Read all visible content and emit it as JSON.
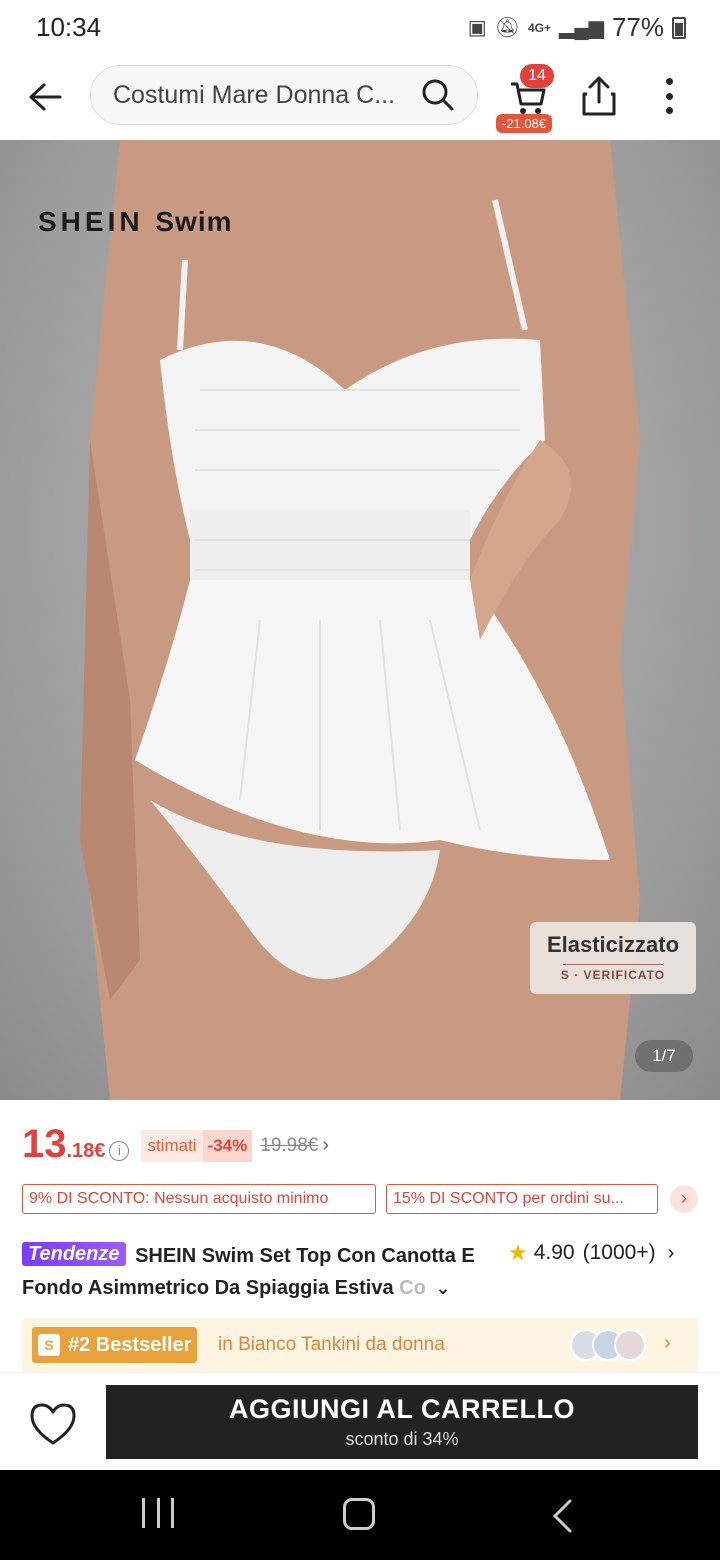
{
  "status_bar": {
    "time": "10:34",
    "network": "4G+",
    "battery": "77%"
  },
  "nav": {
    "search_text": "Costumi Mare Donna C...",
    "cart_count": "14",
    "cart_price": "-21.08€"
  },
  "image": {
    "brand_mark": "SHEIN",
    "brand_mark_sub": "Swim",
    "badge_title": "Elasticizzato",
    "badge_sub": "S · VERIFICATO",
    "page_indicator": "1/7"
  },
  "price": {
    "main": "13",
    "decimals": ".18€",
    "info": "i",
    "estimate_label": "stimati",
    "discount": "-34%",
    "old_price": "19.98€"
  },
  "coupons": [
    {
      "label": "9% DI SCONTO: Nessun acquisto minimo"
    },
    {
      "label": "15% DI SCONTO per ordini su..."
    }
  ],
  "product": {
    "trend_tag": "Tendenze",
    "title": "SHEIN Swim Set Top Con Canotta E Fondo Asimmetrico Da Spiaggia Estiva",
    "title_fade": "Co",
    "rating": "4.90",
    "rating_count": "(1000+)"
  },
  "bestseller": {
    "badge": "#2 Bestseller",
    "text": "in Bianco Tankini da donna"
  },
  "bottom": {
    "add_to_cart": "AGGIUNGI AL CARRELLO",
    "discount_note": "sconto di 34%"
  },
  "colors": {
    "accent_red": "#e2423b",
    "bestseller_orange": "#e8a13b",
    "trend_purple": "#7a3df5",
    "button_dark": "#222222"
  }
}
